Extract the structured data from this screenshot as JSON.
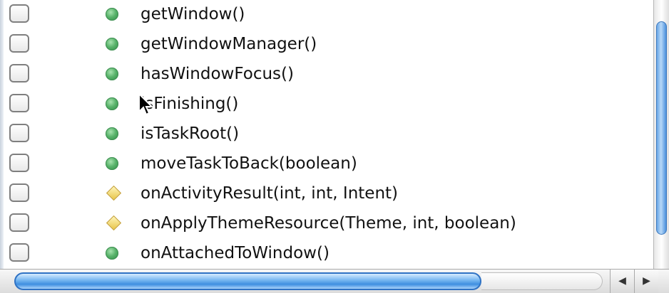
{
  "methods": [
    {
      "label": "getWindow()",
      "visibility": "public"
    },
    {
      "label": "getWindowManager()",
      "visibility": "public"
    },
    {
      "label": "hasWindowFocus()",
      "visibility": "public"
    },
    {
      "label": "isFinishing()",
      "visibility": "public"
    },
    {
      "label": "isTaskRoot()",
      "visibility": "public"
    },
    {
      "label": "moveTaskToBack(boolean)",
      "visibility": "public"
    },
    {
      "label": "onActivityResult(int, int, Intent)",
      "visibility": "protected"
    },
    {
      "label": "onApplyThemeResource(Theme, int, boolean)",
      "visibility": "protected"
    },
    {
      "label": "onAttachedToWindow()",
      "visibility": "public"
    }
  ],
  "icons": {
    "public": "public-method-icon",
    "protected": "protected-method-icon",
    "scroll_left": "◀",
    "scroll_right": "▶"
  },
  "colors": {
    "public_icon": "#58b26a",
    "protected_icon": "#e8c54a",
    "scroll_thumb": "#3e8fe0"
  }
}
